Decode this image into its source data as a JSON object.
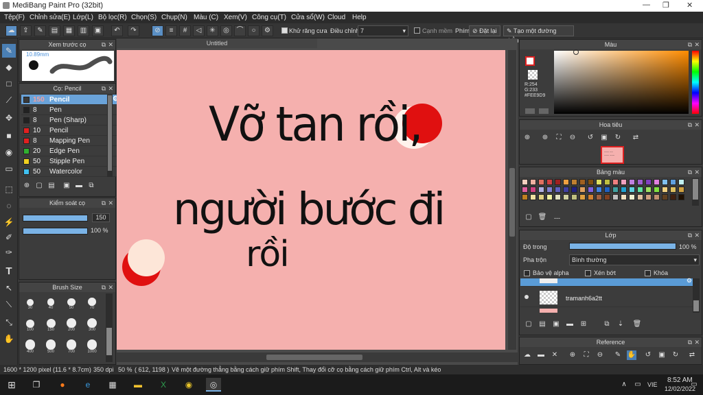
{
  "window": {
    "title": "MediBang Paint Pro (32bit)",
    "minimize": "—",
    "maximize": "❐",
    "close": "✕"
  },
  "menu": [
    "Tệp(F)",
    "Chỉnh sửa(E)",
    "Lớp(L)",
    "Bộ lọc(R)",
    "Chọn(S)",
    "Chụp(N)",
    "Màu (C)",
    "Xem(V)",
    "Công cụ(T)",
    "Cửa sổ(W)",
    "Cloud",
    "Help"
  ],
  "toolbar": {
    "antialias_label": "Khử răng cưa",
    "correction_label": "Điều chỉnh",
    "correction_value": "7",
    "edge_label": "Cạnh mềm",
    "key_label": "Phím",
    "reset_label": "Đặt lại",
    "line_label": "Tạo một đường thẳng"
  },
  "brush_preview": {
    "title": "Xem trước cọ",
    "size": "10.89mm"
  },
  "brush_panel": {
    "title": "Cọ: Pencil",
    "items": [
      {
        "size": "150",
        "name": "Pencil",
        "color": "#3a3a3a"
      },
      {
        "size": "8",
        "name": "Pen",
        "color": "#222222"
      },
      {
        "size": "8",
        "name": "Pen (Sharp)",
        "color": "#222222"
      },
      {
        "size": "10",
        "name": "Pencil",
        "color": "#e02020"
      },
      {
        "size": "8",
        "name": "Mapping Pen",
        "color": "#e02020"
      },
      {
        "size": "20",
        "name": "Edge Pen",
        "color": "#30b030"
      },
      {
        "size": "50",
        "name": "Stipple Pen",
        "color": "#f0d020"
      },
      {
        "size": "50",
        "name": "Watercolor",
        "color": "#40c0f0"
      }
    ]
  },
  "brush_control": {
    "title": "Kiểm soát cọ",
    "size_value": "150",
    "opacity_value": "100 %",
    "size_fraction": 1.0,
    "opacity_fraction": 1.0
  },
  "brush_size": {
    "title": "Brush Size",
    "sizes": [
      "30",
      "40",
      "50",
      "70",
      "100",
      "150",
      "200",
      "300",
      "400",
      "500",
      "700",
      "1000"
    ]
  },
  "canvas": {
    "tab": "Untitled",
    "text_line1": "Vỡ tan rồi,",
    "text_line2": "người bước đi",
    "text_line3": "rồi",
    "bg_color": "#f5b0ae",
    "moon_red": "#e01010",
    "moon_cream": "#fde6d8"
  },
  "color_panel": {
    "title": "Màu",
    "r": "R:254",
    "g": "G:233",
    "b": "B:217",
    "hex": "#FEE9D9"
  },
  "navigator": {
    "title": "Hoa tiêu"
  },
  "palette": {
    "title": "Bảng màu",
    "footer": "---",
    "colors": [
      "#f4d0c0",
      "#f0b0a0",
      "#e07060",
      "#d04040",
      "#a02020",
      "#f0a040",
      "#c08030",
      "#a06020",
      "#805010",
      "#e0e060",
      "#c0c040",
      "#f08080",
      "#f0a0c0",
      "#c080e0",
      "#a060d0",
      "#8040c0",
      "#e080e0",
      "#80c0f0",
      "#60a0e0",
      "#c0f0f0",
      "#e060a0",
      "#d04080",
      "#b0b0e0",
      "#8080d0",
      "#6060c0",
      "#4040a0",
      "#202080",
      "#e0a060",
      "#8060e0",
      "#4080e0",
      "#2060c0",
      "#40a0a0",
      "#20a0d0",
      "#60d0e0",
      "#60e0a0",
      "#a0e060",
      "#80e040",
      "#f0d080",
      "#e0c060",
      "#d0a040",
      "#c08020",
      "#f0e0a0",
      "#e0d080",
      "#f0f0a0",
      "#e0e0c0",
      "#d0d0a0",
      "#c0c080",
      "#e0a040",
      "#d08030",
      "#a06040",
      "#804020",
      "#c0c0c0",
      "#f0e0c0",
      "#f0f0d0",
      "#e0c0a0",
      "#d0a080",
      "#c09070",
      "#604020",
      "#402010",
      "#201000"
    ]
  },
  "layer_panel": {
    "title": "Lớp",
    "opacity_label": "Độ trong",
    "opacity_value": "100 %",
    "opacity_fraction": 1.0,
    "blend_label": "Pha trộn",
    "blend_value": "Bình thường",
    "protect_alpha": "Bảo vệ alpha",
    "clipping": "Xén bớt",
    "lock": "Khóa",
    "layers": [
      {
        "name": "tramanh6a2tt"
      }
    ]
  },
  "reference": {
    "title": "Reference"
  },
  "status": {
    "dimensions": "1600 * 1200 pixel",
    "size": "(11.6 * 8.7cm)",
    "dpi": "350 dpi",
    "zoom": "50 %",
    "coords": "( 612, 1198 )",
    "hint": "Vẽ một đường thẳng bằng cách giữ phím Shift, Thay đổi cỡ cọ bằng cách giữ phím Ctrl, Alt và kéo"
  },
  "taskbar": {
    "lang": "VIE",
    "time": "8:52 AM",
    "date": "12/02/2022"
  }
}
